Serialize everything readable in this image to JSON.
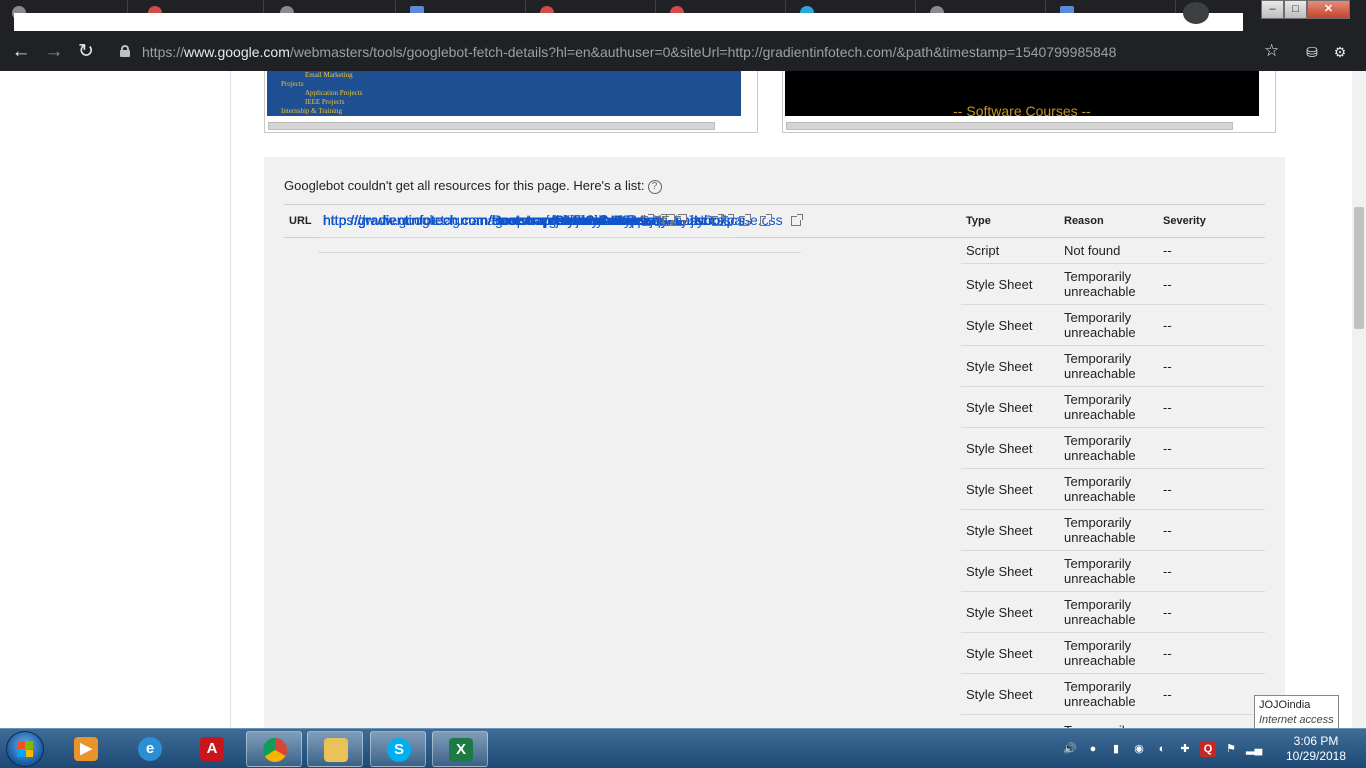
{
  "browser": {
    "url_scheme": "https://",
    "url_host": "www.google.com",
    "url_path": "/webmasters/tools/googlebot-fetch-details?hl=en&authuser=0&siteUrl=http://gradientinfotech.com/&path&timestamp=1540799985848",
    "window_controls": {
      "minimize": "–",
      "maximize": "□",
      "close": "✕"
    }
  },
  "preview": {
    "left_menu": [
      "Email Marketing",
      "Projects",
      "Application Projects",
      "IEEE Projects",
      "Internship & Training"
    ],
    "right_banner": "-- Software Courses --"
  },
  "resources": {
    "intro": "Googlebot couldn't get all resources for this page. Here's a list:",
    "headers": {
      "url": "URL",
      "type": "Type",
      "reason": "Reason",
      "severity": "Severity"
    },
    "rows": [
      {
        "url": "https://www.googletagmanager.com/gtm.js?id=GTM-PDVBJND",
        "type": "Script",
        "reason": "Not found",
        "severity": "--"
      },
      {
        "url": "http://gradientinfotech.com/bootstrap/CicularCarosel/style.css",
        "type": "Style Sheet",
        "reason": "Temporarily unreachable",
        "severity": "--"
      },
      {
        "url": "http://gradientinfotech.com/bootstrap/CicularCarosel/jquery.jscrollpane.css",
        "type": "Style Sheet",
        "reason": "Temporarily unreachable",
        "severity": "--"
      },
      {
        "url": "http://gradientinfotech.com/Bootstrap/js/fancybox/jquery.fancybox.css",
        "type": "Style Sheet",
        "reason": "Temporarily unreachable",
        "severity": "--"
      },
      {
        "url": "http://gradientinfotech.com/Bootstrap/css/bootstrap.css",
        "type": "Style Sheet",
        "reason": "Temporarily unreachable",
        "severity": "--"
      },
      {
        "url": "http://gradientinfotech.com/Bootstrap/css/style.css",
        "type": "Style Sheet",
        "reason": "Temporarily unreachable",
        "severity": "--"
      },
      {
        "url": "http://gradientinfotech.com/Bootstrap/skin/default.css",
        "type": "Style Sheet",
        "reason": "Temporarily unreachable",
        "severity": "--"
      },
      {
        "url": "http://gradientinfotech.com/ResponsiveMenu/Newmenu/menu.css",
        "type": "Style Sheet",
        "reason": "Temporarily unreachable",
        "severity": "--"
      },
      {
        "url": "http://gradientinfotech.com/bootstrap/StyleSheet.css",
        "type": "Style Sheet",
        "reason": "Temporarily unreachable",
        "severity": "--"
      },
      {
        "url": "http://gradientinfotech.com/bootstrap/css/animate.css",
        "type": "Style Sheet",
        "reason": "Temporarily unreachable",
        "severity": "--"
      },
      {
        "url": "http://gradientinfotech.com/bootstrap/CommanStyle.css",
        "type": "Style Sheet",
        "reason": "Temporarily unreachable",
        "severity": "--"
      },
      {
        "url": "http://gradientinfotech.com/bootstrap/StyleSheet2.css",
        "type": "Style Sheet",
        "reason": "Temporarily unreachable",
        "severity": "--"
      },
      {
        "url": "",
        "type": "",
        "reason": "Temporarily",
        "severity": ""
      }
    ]
  },
  "tooltip": {
    "title": "JOJOindia",
    "subtitle": "Internet access"
  },
  "taskbar": {
    "apps": [
      {
        "name": "media-player-icon",
        "glyph": "▶"
      },
      {
        "name": "internet-explorer-icon",
        "glyph": "e"
      },
      {
        "name": "acrobat-icon",
        "glyph": "A"
      },
      {
        "name": "chrome-icon",
        "glyph": ""
      },
      {
        "name": "folder-icon",
        "glyph": ""
      },
      {
        "name": "skype-icon",
        "glyph": "S"
      },
      {
        "name": "excel-icon",
        "glyph": "X"
      }
    ],
    "tray_icons": [
      "volume-icon",
      "chat-icon",
      "battery-icon",
      "settings-icon",
      "network-app-icon",
      "tool-icon",
      "q-icon",
      "flag-icon",
      "signal-icon"
    ],
    "time": "3:06 PM",
    "date": "10/29/2018"
  },
  "colors": {
    "link": "#1155cc",
    "panel_bg": "#f1f1f1",
    "browser_chrome": "#202124"
  }
}
